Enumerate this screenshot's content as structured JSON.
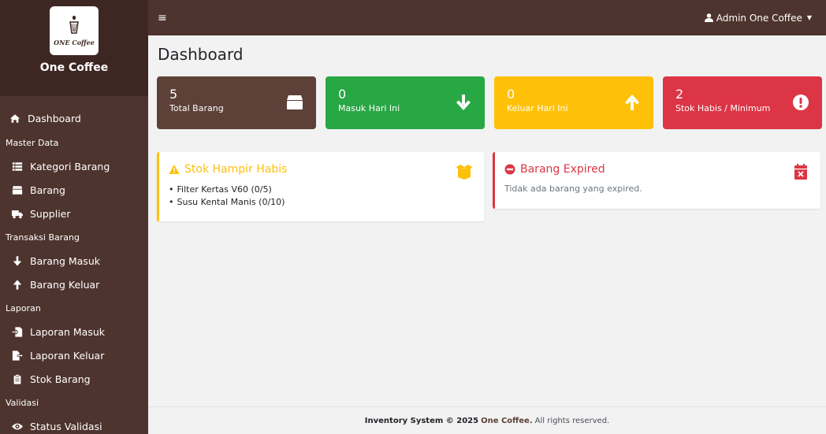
{
  "brand": {
    "logo_text": "ONE Coffee",
    "name": "One Coffee"
  },
  "sidebar": {
    "dashboard": "Dashboard",
    "sections": [
      {
        "heading": "Master Data",
        "items": [
          {
            "label": "Kategori Barang",
            "icon": "list-icon"
          },
          {
            "label": "Barang",
            "icon": "box-icon"
          },
          {
            "label": "Supplier",
            "icon": "truck-icon"
          }
        ]
      },
      {
        "heading": "Transaksi Barang",
        "items": [
          {
            "label": "Barang Masuk",
            "icon": "arrow-down-icon"
          },
          {
            "label": "Barang Keluar",
            "icon": "arrow-up-icon"
          }
        ]
      },
      {
        "heading": "Laporan",
        "items": [
          {
            "label": "Laporan Masuk",
            "icon": "file-import-icon"
          },
          {
            "label": "Laporan Keluar",
            "icon": "file-export-icon"
          },
          {
            "label": "Stok Barang",
            "icon": "clipboard-icon"
          }
        ]
      },
      {
        "heading": "Validasi",
        "items": [
          {
            "label": "Status Validasi",
            "icon": "eye-icon"
          }
        ]
      }
    ]
  },
  "topbar": {
    "menu_glyph": "≡",
    "user_name": "Admin One Coffee"
  },
  "page": {
    "title": "Dashboard"
  },
  "cards": [
    {
      "value": "5",
      "label": "Total Barang",
      "color": "#5d4037",
      "icon": "box-icon"
    },
    {
      "value": "0",
      "label": "Masuk Hari Ini",
      "color": "#28a745",
      "icon": "arrow-down-icon"
    },
    {
      "value": "0",
      "label": "Keluar Hari Ini",
      "color": "#ffc107",
      "icon": "arrow-up-icon"
    },
    {
      "value": "2",
      "label": "Stok Habis / Minimum",
      "color": "#dc3545",
      "icon": "exclamation-circle-icon"
    }
  ],
  "low_stock": {
    "title": "Stok Hampir Habis",
    "items": [
      "Filter Kertas V60 (0/5)",
      "Susu Kental Manis (0/10)"
    ]
  },
  "expired": {
    "title": "Barang Expired",
    "message": "Tidak ada barang yang expired."
  },
  "footer": {
    "prefix": "Inventory System © 2025",
    "brand": "One Coffee.",
    "rights": "All rights reserved."
  }
}
